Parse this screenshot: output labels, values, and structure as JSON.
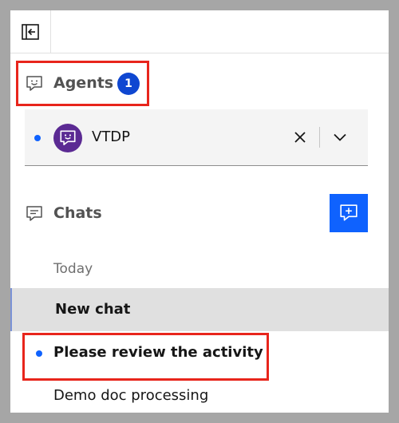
{
  "sidebar": {
    "collapse_icon": "panel-collapse-icon",
    "agents": {
      "title": "Agents",
      "count": "1",
      "icon": "agent-face-icon",
      "selected_agent": {
        "name": "VTDP",
        "status": "unread",
        "avatar_icon": "agent-face-icon"
      }
    },
    "chats": {
      "title": "Chats",
      "icon": "chat-bubble-icon",
      "new_chat_icon": "chat-add-icon",
      "group_label": "Today",
      "items": [
        {
          "label": "New chat",
          "selected": true,
          "unread": false
        },
        {
          "label": "Please review the activity",
          "selected": false,
          "unread": true
        },
        {
          "label": "Demo doc processing",
          "selected": false,
          "unread": false
        }
      ]
    }
  },
  "colors": {
    "accent": "#0f62fe",
    "badge": "#0f47d1",
    "avatar": "#5b2a93",
    "highlight": "#e8251c",
    "selected_row": "#e0e0e0"
  }
}
